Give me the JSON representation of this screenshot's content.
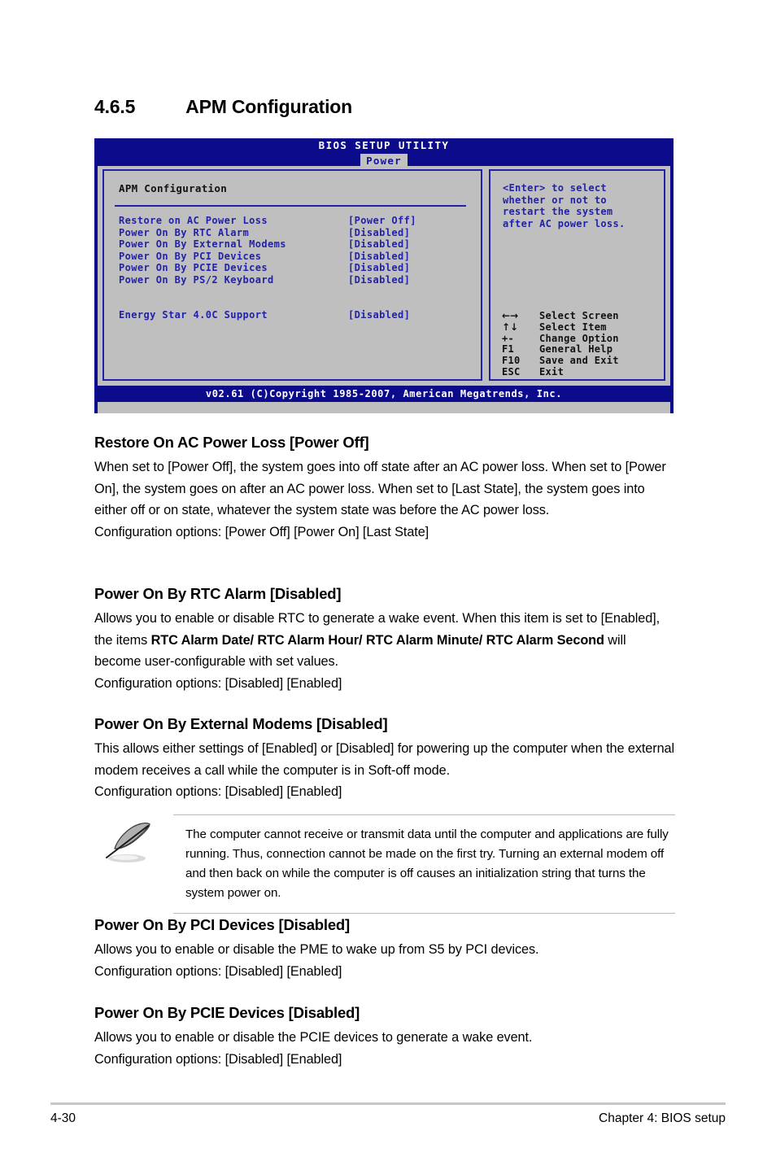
{
  "section": {
    "number": "4.6.5",
    "title": "APM Configuration"
  },
  "bios": {
    "title": "BIOS SETUP UTILITY",
    "active_tab": "Power",
    "panel_heading": "APM Configuration",
    "options": [
      {
        "label": "Restore on AC Power Loss",
        "value": "[Power Off]"
      },
      {
        "label": "Power On By RTC Alarm",
        "value": "[Disabled]"
      },
      {
        "label": "Power On By External Modems",
        "value": "[Disabled]"
      },
      {
        "label": "Power On By PCI Devices",
        "value": "[Disabled]"
      },
      {
        "label": "Power On By PCIE Devices",
        "value": "[Disabled]"
      },
      {
        "label": "Power On By PS/2 Keyboard",
        "value": "[Disabled]"
      }
    ],
    "extra_option": {
      "label": "Energy Star 4.0C Support",
      "value": "[Disabled]"
    },
    "help_lines": [
      "<Enter> to select",
      "whether or not to",
      "restart the system",
      "after AC power loss."
    ],
    "legend": [
      {
        "key": "←→",
        "desc": "Select Screen",
        "icon": "left-right-arrow-icon"
      },
      {
        "key": "↑↓",
        "desc": "Select Item",
        "icon": "up-down-arrow-icon"
      },
      {
        "key": "+-",
        "desc": "Change Option",
        "icon": "plus-minus-icon"
      },
      {
        "key": "F1",
        "desc": "General Help",
        "icon": "f1-key-icon"
      },
      {
        "key": "F10",
        "desc": "Save and Exit",
        "icon": "f10-key-icon"
      },
      {
        "key": "ESC",
        "desc": "Exit",
        "icon": "esc-key-icon"
      }
    ],
    "footer": "v02.61 (C)Copyright 1985-2007, American Megatrends, Inc.",
    "colors": {
      "header_blue": "#0b0b8c",
      "panel_gray": "#bfbfbf",
      "text_blue": "#2222a8",
      "tab_bg": "#c2c2c2"
    }
  },
  "items": [
    {
      "heading": "Restore On AC Power Loss [Power Off]",
      "body_html": "When set to [Power Off], the system goes into off state after an AC power loss. When set to [Power On], the system goes on after an AC power loss. When set to [Last State], the system goes into either off or on state, whatever the system state was before the AC power loss.<br>Configuration options: [Power Off] [Power On] [Last State]"
    },
    {
      "heading": "Power On By RTC Alarm [Disabled]",
      "body_html": "Allows you to enable or disable RTC to generate a wake event. When this item is set to [Enabled], the items <b>RTC Alarm Date/ RTC Alarm Hour/ RTC Alarm Minute/ RTC Alarm Second</b> will become user-configurable with set values.<br>Configuration options: [Disabled] [Enabled]"
    },
    {
      "heading": "Power On By External Modems [Disabled]",
      "body_html": "This allows either settings of [Enabled] or [Disabled] for powering up the computer when the external modem receives a call while the computer is in Soft-off mode.<br>Configuration options: [Disabled] [Enabled]"
    },
    {
      "heading": "Power On By PCI Devices [Disabled]",
      "body_html": "Allows you to enable or disable the PME to wake up from S5 by PCI devices.<br>Configuration options: [Disabled] [Enabled]"
    },
    {
      "heading": "Power On By PCIE Devices [Disabled]",
      "body_html": "Allows you to enable or disable the PCIE devices to generate a wake event.<br>Configuration options: [Disabled] [Enabled]"
    }
  ],
  "note": {
    "icon": "quill-pen-icon",
    "text": "The computer cannot receive or transmit data until the computer and applications are fully running. Thus, connection cannot be made on the first try. Turning an external modem off and then back on while the computer is off causes an initialization string that turns the system power on."
  },
  "page_footer": {
    "page_number": "4-30",
    "chapter": "Chapter 4: BIOS setup"
  }
}
